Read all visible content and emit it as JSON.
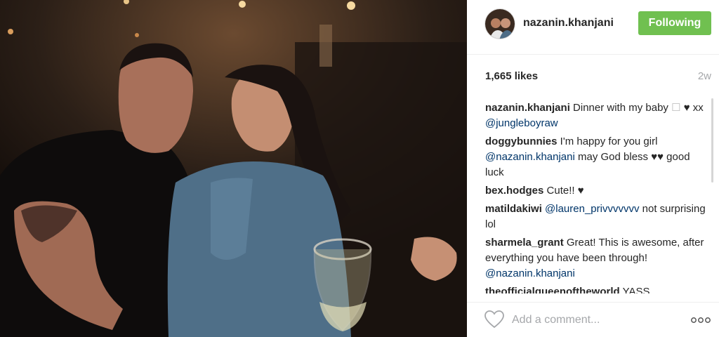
{
  "post": {
    "username": "nazanin.khanjani",
    "follow_label": "Following",
    "likes": "1,665 likes",
    "age": "2w",
    "caption_text": "Dinner with my baby ",
    "caption_glyph": "☐",
    "caption_heart": "♥",
    "caption_xx": " xx ",
    "caption_mention": "@jungleboyraw",
    "comments": [
      {
        "user": "doggybunnies",
        "text": "I'm happy for you girl ",
        "mention": "@nazanin.khanjani",
        "tail": " may God bless ♥♥ good luck"
      },
      {
        "user": "bex.hodges",
        "text": "Cute!! ♥"
      },
      {
        "user": "matildakiwi",
        "mention": "@lauren_privvvvvvv",
        "tail": " not surprising lol"
      },
      {
        "user": "sharmela_grant",
        "text": "Great! This is awesome, after everything you have been through! ",
        "mention": "@nazanin.khanjani"
      },
      {
        "user": "theofficialqueenoftheworld",
        "text": "YASS"
      }
    ],
    "add_comment_placeholder": "Add a comment...",
    "more_label": "ooo"
  },
  "icons": {
    "heart": "heart-outline-icon",
    "more": "more-options-icon"
  },
  "colors": {
    "follow": "#70c050",
    "mention": "#003569",
    "muted": "#a5a7aa"
  }
}
